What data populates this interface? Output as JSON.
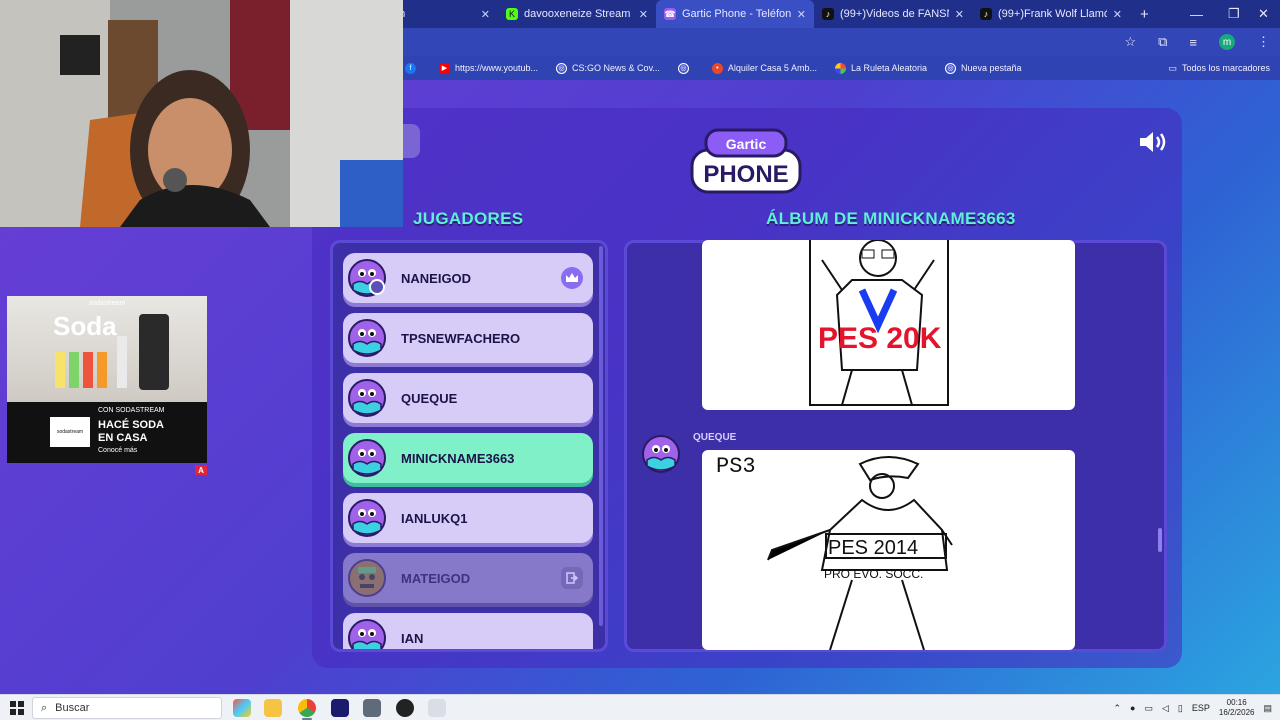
{
  "browser": {
    "tabs": [
      {
        "title": "am",
        "icon": "twitch-icon",
        "active": false
      },
      {
        "title": "davooxeneize Stream - Watch Live",
        "icon": "kick-icon",
        "active": false
      },
      {
        "title": "Gartic Phone - Teléfono Descompuesto",
        "icon": "gartic-icon",
        "active": true
      },
      {
        "title": "(99+)Videos de FANSNANEIGOD",
        "icon": "tiktok-icon",
        "active": false
      },
      {
        "title": "(99+)Frank Wolf Llamó a Naneigod",
        "icon": "tiktok-icon",
        "active": false
      }
    ],
    "new_tab": "+",
    "bookmarks": [
      {
        "label": "",
        "icon": "facebook-icon"
      },
      {
        "label": "https://www.youtub...",
        "icon": "youtube-icon"
      },
      {
        "label": "CS:GO News & Cov...",
        "icon": "globe-icon"
      },
      {
        "label": "",
        "icon": "globe-icon"
      },
      {
        "label": "Alquiler Casa 5 Amb...",
        "icon": "pin-icon"
      },
      {
        "label": "La Ruleta Aleatoria",
        "icon": "wheel-icon"
      },
      {
        "label": "Nueva pestaña",
        "icon": "globe-icon"
      }
    ],
    "all_bookmarks": "Todos los marcadores",
    "profile_initial": "m"
  },
  "game": {
    "logo_top": "Gartic",
    "logo_bottom": "PHONE",
    "players_title": "JUGADORES",
    "album_title": "ÁLBUM DE MINICKNAME3663",
    "players": [
      {
        "name": "NANEIGOD",
        "state": "host"
      },
      {
        "name": "TPSNEWFACHERO",
        "state": "normal"
      },
      {
        "name": "QUEQUE",
        "state": "normal"
      },
      {
        "name": "MINICKNAME3663",
        "state": "me"
      },
      {
        "name": "IANLUKQ1",
        "state": "normal"
      },
      {
        "name": "MATEIGOD",
        "state": "left"
      },
      {
        "name": "IAN",
        "state": "normal"
      }
    ],
    "album_author": "QUEQUE",
    "drawing1_text": "PES 20K",
    "drawing2_texts": [
      "PS3",
      "PES 2014",
      "PRO EVO. SOCC."
    ]
  },
  "ad": {
    "brand": "sodastream",
    "headline_word": "Soda",
    "line1": "CON SODASTREAM",
    "line2": "HACÉ SODA",
    "line3": "EN CASA",
    "cta": "Conocé más",
    "logo_text": "sodastream",
    "flag": "A"
  },
  "taskbar": {
    "search_placeholder": "Buscar",
    "lang": "ESP",
    "time": "00:16",
    "date": "16/2/2026"
  }
}
